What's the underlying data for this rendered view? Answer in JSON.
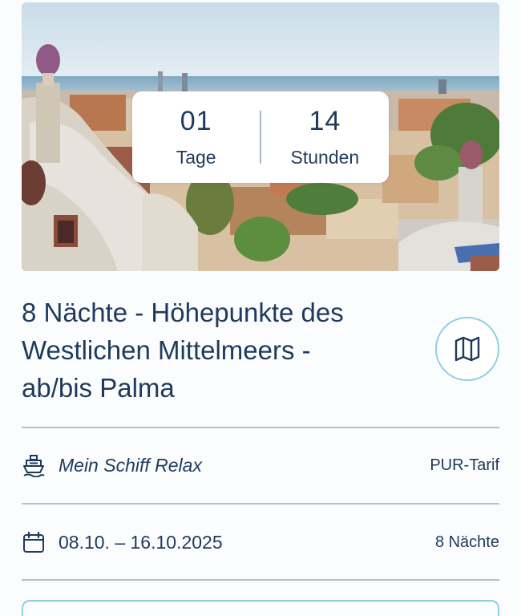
{
  "countdown": {
    "days_value": "01",
    "days_label": "Tage",
    "hours_value": "14",
    "hours_label": "Stunden"
  },
  "trip": {
    "title_line1": "8 Nächte - Höhepunkte des",
    "title_line2": "Westlichen Mittelmeers -",
    "title_line3": "ab/bis Palma"
  },
  "ship_row": {
    "icon": "ship-icon",
    "ship_name": "Mein Schiff Relax",
    "tariff": "PUR-Tarif"
  },
  "date_row": {
    "icon": "calendar-icon",
    "date_range": "08.10. – 16.10.2025",
    "nights": "8 Nächte"
  },
  "map_button": {
    "icon": "map-icon"
  },
  "colors": {
    "text": "#1f3a5c",
    "accent_border": "#8ccfe0",
    "divider": "#b4c0cb"
  }
}
